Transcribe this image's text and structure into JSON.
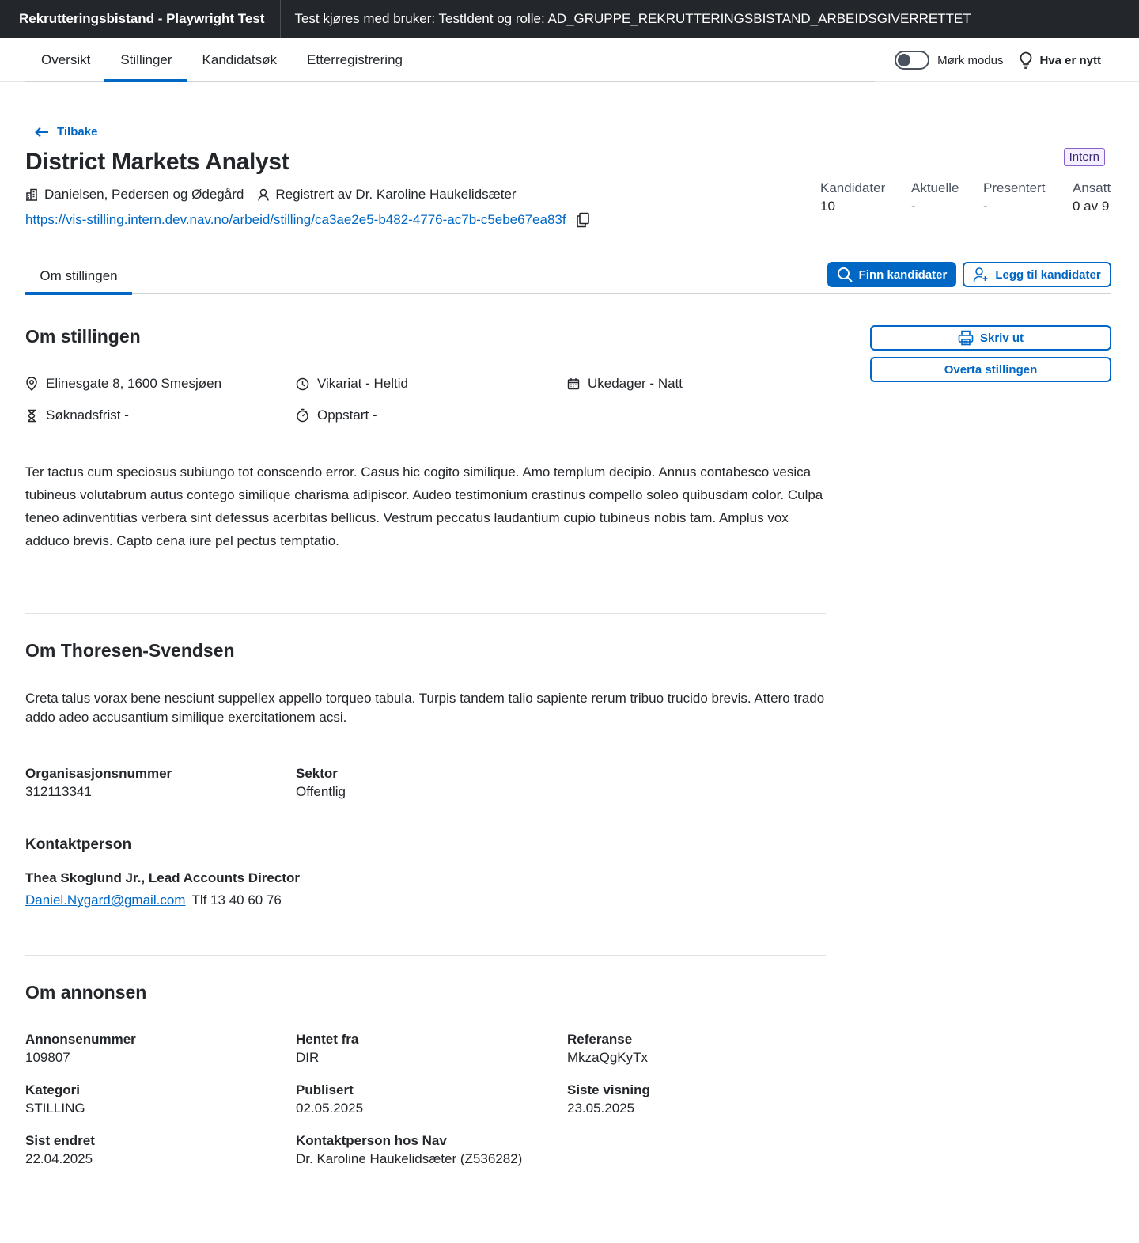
{
  "topbar": {
    "app_title": "Rekrutteringsbistand - Playwright Test",
    "test_info": "Test kjøres med bruker: TestIdent og rolle: AD_GRUPPE_REKRUTTERINGSBISTAND_ARBEIDSGIVERRETTET"
  },
  "nav": {
    "tabs": [
      {
        "label": "Oversikt"
      },
      {
        "label": "Stillinger",
        "active": true
      },
      {
        "label": "Kandidatsøk"
      },
      {
        "label": "Etterregistrering"
      }
    ],
    "dark_mode_label": "Mørk modus",
    "dark_mode_on": false,
    "whats_new_label": "Hva er nytt"
  },
  "page": {
    "back_label": "Tilbake",
    "title": "District Markets Analyst",
    "employer": "Danielsen, Pedersen og Ødegård",
    "registered_by": "Registrert av Dr. Karoline Haukelidsæter",
    "url": "https://vis-stilling.intern.dev.nav.no/arbeid/stilling/ca3ae2e5-b482-4776-ac7b-c5ebe67ea83f",
    "badge": "Intern"
  },
  "stats": [
    {
      "label": "Kandidater",
      "value": "10"
    },
    {
      "label": "Aktuelle",
      "value": "-"
    },
    {
      "label": "Presentert",
      "value": "-"
    },
    {
      "label": "Ansatt",
      "value": "0 av 9"
    }
  ],
  "subtab": "Om stillingen",
  "actions": {
    "find_candidates": "Finn kandidater",
    "add_candidates": "Legg til kandidater",
    "print": "Skriv ut",
    "take_over": "Overta stillingen"
  },
  "about_position": {
    "heading": "Om stillingen",
    "address": "Elinesgate 8, 1600 Smesjøen",
    "employment": "Vikariat - Heltid",
    "schedule": "Ukedager - Natt",
    "deadline": "Søknadsfrist -",
    "start": "Oppstart -",
    "description": "Ter tactus cum speciosus subiungo tot conscendo error. Casus hic cogito similique. Amo templum decipio. Annus contabesco vesica tubineus volutabrum autus contego similique charisma adipiscor. Audeo testimonium crastinus compello soleo quibusdam color. Culpa teneo adinventitias verbera sint defessus acerbitas bellicus. Vestrum peccatus laudantium cupio tubineus nobis tam. Amplus vox adduco brevis. Capto cena iure pel pectus temptatio."
  },
  "about_employer": {
    "heading": "Om Thoresen-Svendsen",
    "description": "Creta talus vorax bene nesciunt suppellex appello torqueo tabula. Turpis tandem talio sapiente rerum tribuo trucido brevis. Attero trado addo adeo accusantium similique exercitationem acsi.",
    "org_label": "Organisasjonsnummer",
    "org_value": "312113341",
    "sector_label": "Sektor",
    "sector_value": "Offentlig",
    "contact_heading": "Kontaktperson",
    "contact_name": "Thea Skoglund Jr., Lead Accounts Director",
    "contact_email": "Daniel.Nygard@gmail.com",
    "contact_phone": "Tlf 13 40 60 76"
  },
  "about_ad": {
    "heading": "Om annonsen",
    "fields": [
      {
        "label": "Annonsenummer",
        "value": "109807"
      },
      {
        "label": "Hentet fra",
        "value": "DIR"
      },
      {
        "label": "Referanse",
        "value": "MkzaQgKyTx"
      },
      {
        "label": "Kategori",
        "value": "STILLING"
      },
      {
        "label": "Publisert",
        "value": "02.05.2025"
      },
      {
        "label": "Siste visning",
        "value": "23.05.2025"
      },
      {
        "label": "Sist endret",
        "value": "22.04.2025"
      },
      {
        "label": "Kontaktperson hos Nav",
        "value": "Dr. Karoline Haukelidsæter (Z536282)"
      }
    ]
  },
  "colors": {
    "accent": "#0067c5",
    "topbar_bg": "#23262a",
    "badge_border": "#8962c9"
  }
}
